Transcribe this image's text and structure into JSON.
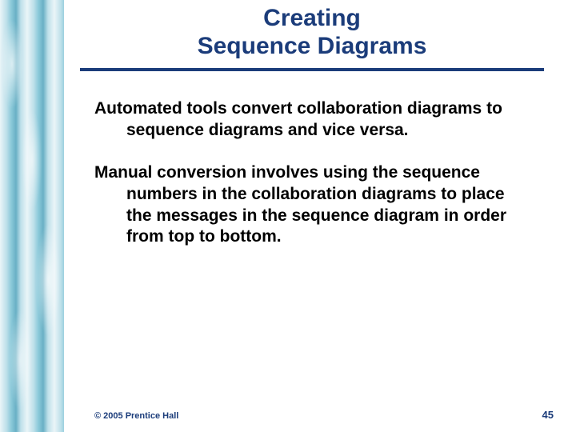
{
  "slide": {
    "title_line1": "Creating",
    "title_line2": "Sequence Diagrams",
    "paragraphs": [
      "Automated tools convert collaboration diagrams to sequence diagrams and vice versa.",
      "Manual conversion involves using the sequence numbers in the collaboration diagrams to place the messages in the sequence diagram in order from top to bottom."
    ],
    "copyright": "© 2005 Prentice Hall",
    "page_number": "45"
  }
}
